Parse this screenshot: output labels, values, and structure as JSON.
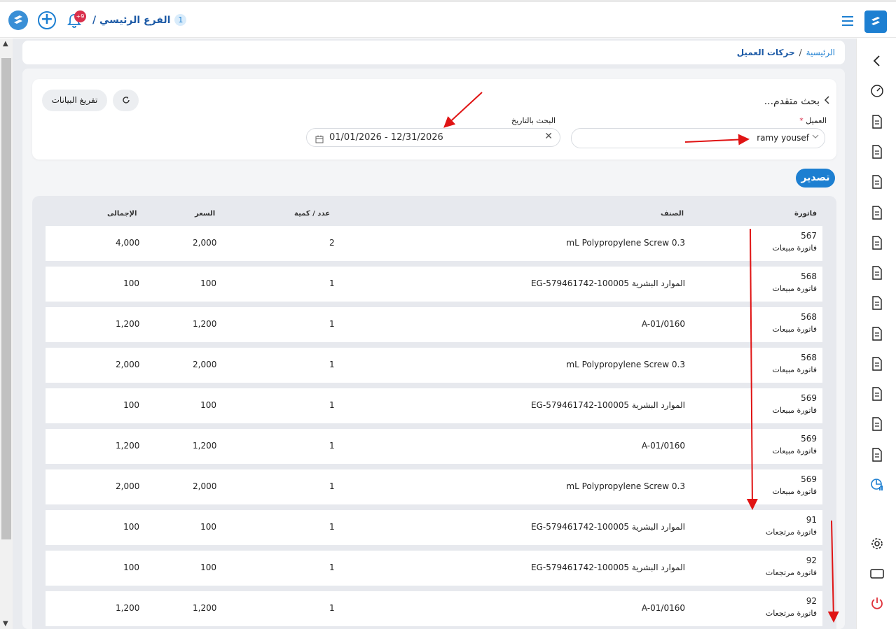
{
  "topbar": {
    "branch_name": "الفرع الرئيسي /",
    "branch_number": "1",
    "notifications_badge": "+9"
  },
  "breadcrumb": {
    "home": "الرئيسية",
    "separator": "/",
    "current": "حركات العميل"
  },
  "filters": {
    "title": "بحث متقدم...",
    "clear_label": "تفريغ البيانات",
    "client_label": "العميل",
    "client_required": "*",
    "client_value": "ramy yousef",
    "date_label": "البحث بالتاريخ",
    "date_value": "01/01/2026 - 12/31/2026"
  },
  "export_label": "تصدير",
  "table": {
    "headers": {
      "invoice": "فاتورة",
      "item": "الصنف",
      "qty": "عدد / كمية",
      "price": "السعر",
      "total": "الإجمالى"
    },
    "rows": [
      {
        "invoice_no": "567",
        "invoice_type": "فاتورة مبيعات",
        "item": "mL Polypropylene Screw 0.3",
        "qty": "2",
        "price": "2,000",
        "total": "4,000"
      },
      {
        "invoice_no": "568",
        "invoice_type": "فاتورة مبيعات",
        "item": "EG-579461742-100005 الموارد البشرية",
        "qty": "1",
        "price": "100",
        "total": "100"
      },
      {
        "invoice_no": "568",
        "invoice_type": "فاتورة مبيعات",
        "item": "A-01/0160",
        "qty": "1",
        "price": "1,200",
        "total": "1,200"
      },
      {
        "invoice_no": "568",
        "invoice_type": "فاتورة مبيعات",
        "item": "mL Polypropylene Screw 0.3",
        "qty": "1",
        "price": "2,000",
        "total": "2,000"
      },
      {
        "invoice_no": "569",
        "invoice_type": "فاتورة مبيعات",
        "item": "EG-579461742-100005 الموارد البشرية",
        "qty": "1",
        "price": "100",
        "total": "100"
      },
      {
        "invoice_no": "569",
        "invoice_type": "فاتورة مبيعات",
        "item": "A-01/0160",
        "qty": "1",
        "price": "1,200",
        "total": "1,200"
      },
      {
        "invoice_no": "569",
        "invoice_type": "فاتورة مبيعات",
        "item": "mL Polypropylene Screw 0.3",
        "qty": "1",
        "price": "2,000",
        "total": "2,000"
      },
      {
        "invoice_no": "91",
        "invoice_type": "فاتورة مرتجعات",
        "item": "EG-579461742-100005 الموارد البشرية",
        "qty": "1",
        "price": "100",
        "total": "100"
      },
      {
        "invoice_no": "92",
        "invoice_type": "فاتورة مرتجعات",
        "item": "EG-579461742-100005 الموارد البشرية",
        "qty": "1",
        "price": "100",
        "total": "100"
      },
      {
        "invoice_no": "92",
        "invoice_type": "فاتورة مرتجعات",
        "item": "A-01/0160",
        "qty": "1",
        "price": "1,200",
        "total": "1,200"
      }
    ]
  },
  "sidebar_icons": [
    "back-chevron-icon",
    "dashboard-icon",
    "truck-invoice-icon",
    "store-icon",
    "document-code-icon",
    "document-cancel-icon",
    "document-lines-icon",
    "document-cancel-icon",
    "document-cancel-icon",
    "monitor-icon",
    "camera-plus-icon",
    "document-plus-icon",
    "cash-icon",
    "document-user-icon",
    "report-chart-icon",
    "settings-icon",
    "window-icon",
    "power-icon"
  ],
  "colors": {
    "accent": "#1d7fd1",
    "annotation_arrow": "#e01414",
    "power": "#e0313a"
  }
}
